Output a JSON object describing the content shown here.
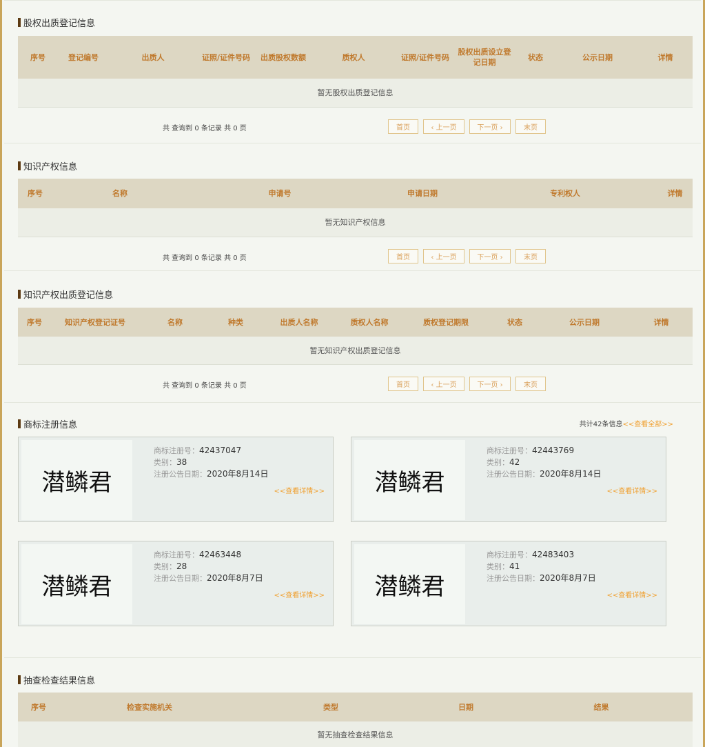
{
  "equity_pledge": {
    "title": "股权出质登记信息",
    "headers": [
      "序号",
      "登记编号",
      "出质人",
      "证照/证件号码",
      "出质股权数额",
      "质权人",
      "证照/证件号码",
      "股权出质设立登记日期",
      "状态",
      "公示日期",
      "详情"
    ],
    "empty_text": "暂无股权出质登记信息"
  },
  "ip": {
    "title": "知识产权信息",
    "headers": [
      "序号",
      "名称",
      "申请号",
      "申请日期",
      "专利权人",
      "详情"
    ],
    "empty_text": "暂无知识产权信息"
  },
  "ip_pledge": {
    "title": "知识产权出质登记信息",
    "headers": [
      "序号",
      "知识产权登记证号",
      "名称",
      "种类",
      "出质人名称",
      "质权人名称",
      "质权登记期限",
      "状态",
      "公示日期",
      "详情"
    ],
    "empty_text": "暂无知识产权出质登记信息"
  },
  "pager": {
    "info": "共 查询到 0 条记录 共 0 页",
    "first": "首页",
    "prev": "‹ 上一页",
    "next": "下一页 ›",
    "last": "末页"
  },
  "trademark": {
    "title": "商标注册信息",
    "total": "共计42条信息",
    "view_all": "<<查看全部>>",
    "reg_label": "商标注册号：",
    "class_label": "类别：",
    "date_label": "注册公告日期：",
    "detail_link": "<<查看详情>>",
    "cards": [
      {
        "name": "潜鳞君",
        "reg_no": "42437047",
        "class": "38",
        "date": "2020年8月14日"
      },
      {
        "name": "潜鳞君",
        "reg_no": "42443769",
        "class": "42",
        "date": "2020年8月14日"
      },
      {
        "name": "潜鳞君",
        "reg_no": "42463448",
        "class": "28",
        "date": "2020年8月7日"
      },
      {
        "name": "潜鳞君",
        "reg_no": "42483403",
        "class": "41",
        "date": "2020年8月7日"
      }
    ]
  },
  "inspection": {
    "title": "抽查检查结果信息",
    "headers": [
      "序号",
      "检查实施机关",
      "类型",
      "日期",
      "结果"
    ],
    "empty_text": "暂无抽查检查结果信息"
  }
}
